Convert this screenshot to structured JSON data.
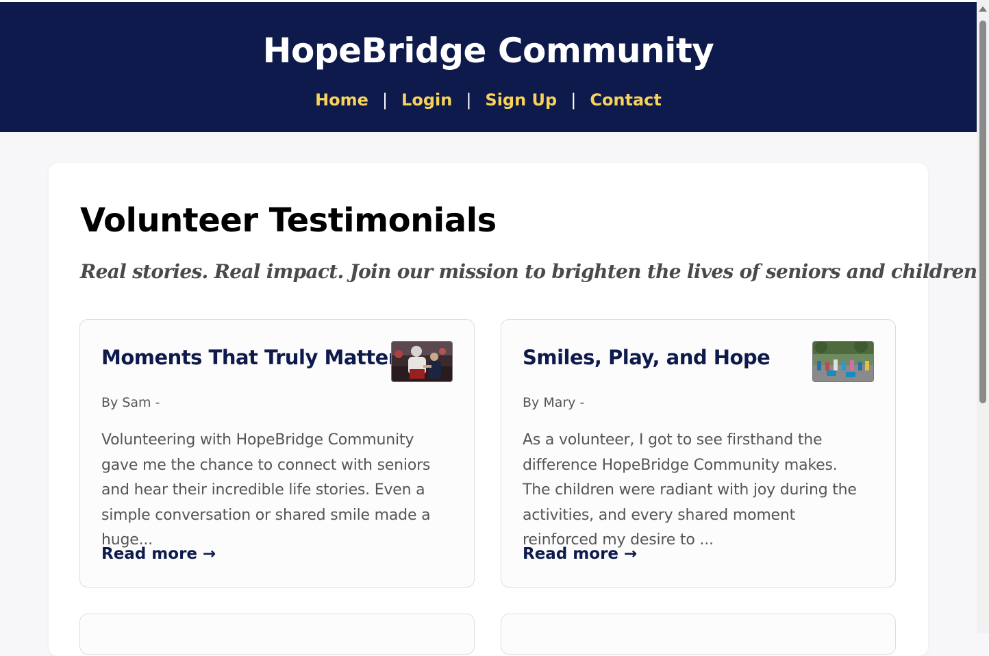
{
  "header": {
    "site_title": "HopeBridge Community",
    "nav": [
      {
        "label": "Home"
      },
      {
        "label": "Login"
      },
      {
        "label": "Sign Up"
      },
      {
        "label": "Contact"
      }
    ],
    "separator": "|"
  },
  "main": {
    "title": "Volunteer Testimonials",
    "tagline": "Real stories. Real impact. Join our mission to brighten the lives of seniors and children.",
    "testimonials": [
      {
        "title": "Moments That Truly Matter",
        "byline": "By Sam -",
        "excerpt": "Volunteering with HopeBridge Community gave me the chance to connect with seniors and hear their incredible life stories. Even a simple conversation or shared smile made a huge...",
        "read_more": "Read more →",
        "thumbnail": "photo-senior-volunteer"
      },
      {
        "title": "Smiles, Play, and Hope",
        "byline": "By Mary -",
        "excerpt": "As a volunteer, I got to see firsthand the difference HopeBridge Community makes. The children were radiant with joy during the activities, and every shared moment reinforced my desire to ...",
        "read_more": "Read more →",
        "thumbnail": "photo-children-outdoor-event"
      }
    ]
  },
  "colors": {
    "header_bg": "#0e1a4b",
    "nav_link": "#f7d35b",
    "accent_text": "#0e1a4b",
    "page_bg": "#f7f7f9"
  }
}
